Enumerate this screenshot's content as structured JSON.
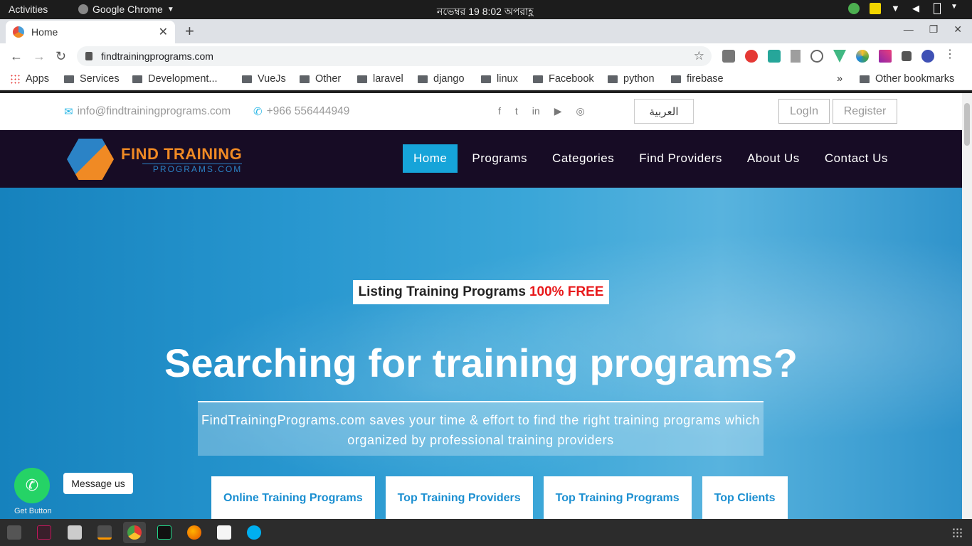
{
  "topbar": {
    "activities": "Activities",
    "app_name": "Google Chrome",
    "clock": "নভেম্বর 19  8:02 অপরাহ্ণ"
  },
  "browser": {
    "tab_title": "Home",
    "url": "findtrainingprograms.com",
    "bookmarks": [
      "Apps",
      "Services",
      "Development...",
      "VueJs",
      "Other",
      "laravel",
      "django",
      "linux",
      "Facebook",
      "python",
      "firebase"
    ],
    "more": "»",
    "other_bookmarks": "Other bookmarks"
  },
  "info": {
    "email": "info@findtrainingprograms.com",
    "phone": "+966 556444949",
    "language_button": "العربية",
    "login": "LogIn",
    "register": "Register"
  },
  "social_icons": [
    "facebook-icon",
    "twitter-icon",
    "linkedin-icon",
    "youtube-icon",
    "instagram-icon"
  ],
  "logo": {
    "line1": "FIND TRAINING",
    "line2": "PROGRAMS.COM"
  },
  "nav": {
    "items": [
      "Home",
      "Programs",
      "Categories",
      "Find Providers",
      "About Us",
      "Contact Us"
    ],
    "active": "Home"
  },
  "hero": {
    "tagline": "Listing Training Programs",
    "tagline_highlight": "100% FREE",
    "headline": "Searching for training programs?",
    "subtext": "FindTrainingPrograms.com saves your time & effort to find the right training programs which organized by professional training providers",
    "buttons": [
      "Online Training Programs",
      "Top Training Providers",
      "Top Training Programs",
      "Top Clients"
    ]
  },
  "whatsapp": {
    "bubble": "Message us",
    "label": "Get Button"
  },
  "colors": {
    "nav_bg": "#170c25",
    "accent": "#16a4d9",
    "brand_orange": "#f08a24",
    "brand_blue": "#2b83c6",
    "free_red": "#e8191b",
    "whatsapp_green": "#25d366"
  }
}
